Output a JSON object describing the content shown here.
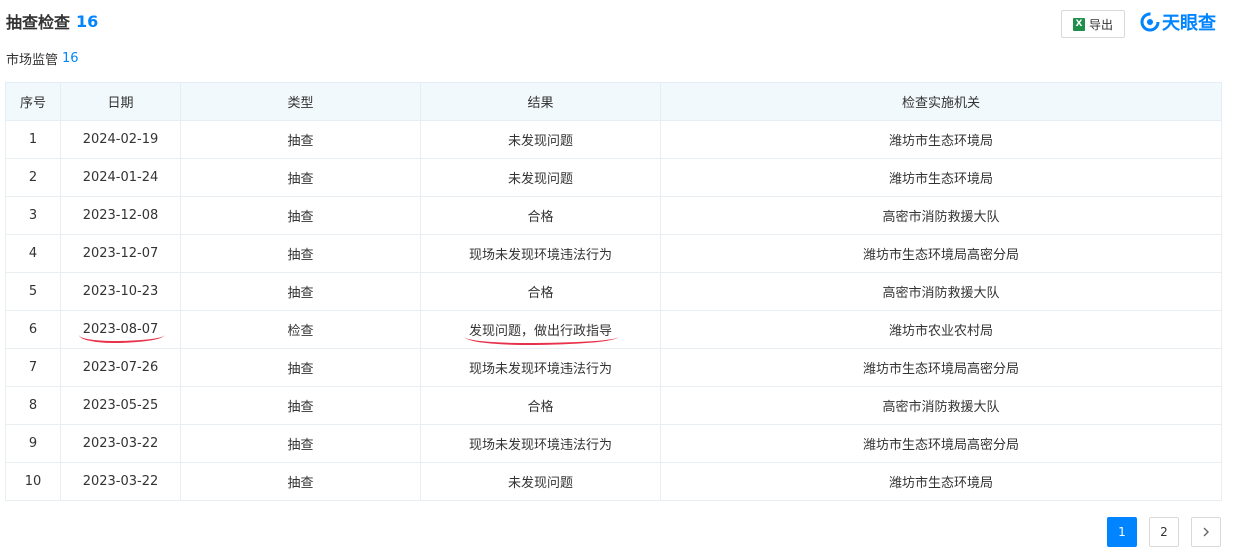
{
  "header": {
    "title": "抽查检查",
    "count": "16"
  },
  "toolbar": {
    "export_label": "导出",
    "excel_icon_letter": "X"
  },
  "brand": {
    "logo_text": "天眼查",
    "color": "#0084ff"
  },
  "subheader": {
    "label": "市场监管",
    "count": "16"
  },
  "table": {
    "columns": [
      "序号",
      "日期",
      "类型",
      "结果",
      "检查实施机关"
    ],
    "rows": [
      [
        "1",
        "2024-02-19",
        "抽查",
        "未发现问题",
        "潍坊市生态环境局"
      ],
      [
        "2",
        "2024-01-24",
        "抽查",
        "未发现问题",
        "潍坊市生态环境局"
      ],
      [
        "3",
        "2023-12-08",
        "抽查",
        "合格",
        "高密市消防救援大队"
      ],
      [
        "4",
        "2023-12-07",
        "抽查",
        "现场未发现环境违法行为",
        "潍坊市生态环境局高密分局"
      ],
      [
        "5",
        "2023-10-23",
        "抽查",
        "合格",
        "高密市消防救援大队"
      ],
      [
        "6",
        "2023-08-07",
        "检查",
        "发现问题，做出行政指导",
        "潍坊市农业农村局"
      ],
      [
        "7",
        "2023-07-26",
        "抽查",
        "现场未发现环境违法行为",
        "潍坊市生态环境局高密分局"
      ],
      [
        "8",
        "2023-05-25",
        "抽查",
        "合格",
        "高密市消防救援大队"
      ],
      [
        "9",
        "2023-03-22",
        "抽查",
        "现场未发现环境违法行为",
        "潍坊市生态环境局高密分局"
      ],
      [
        "10",
        "2023-03-22",
        "抽查",
        "未发现问题",
        "潍坊市生态环境局"
      ]
    ],
    "highlight_color": "#e8324c"
  },
  "pagination": {
    "pages": [
      "1",
      "2"
    ],
    "current": "1",
    "next_icon": "chevron-right-icon"
  }
}
